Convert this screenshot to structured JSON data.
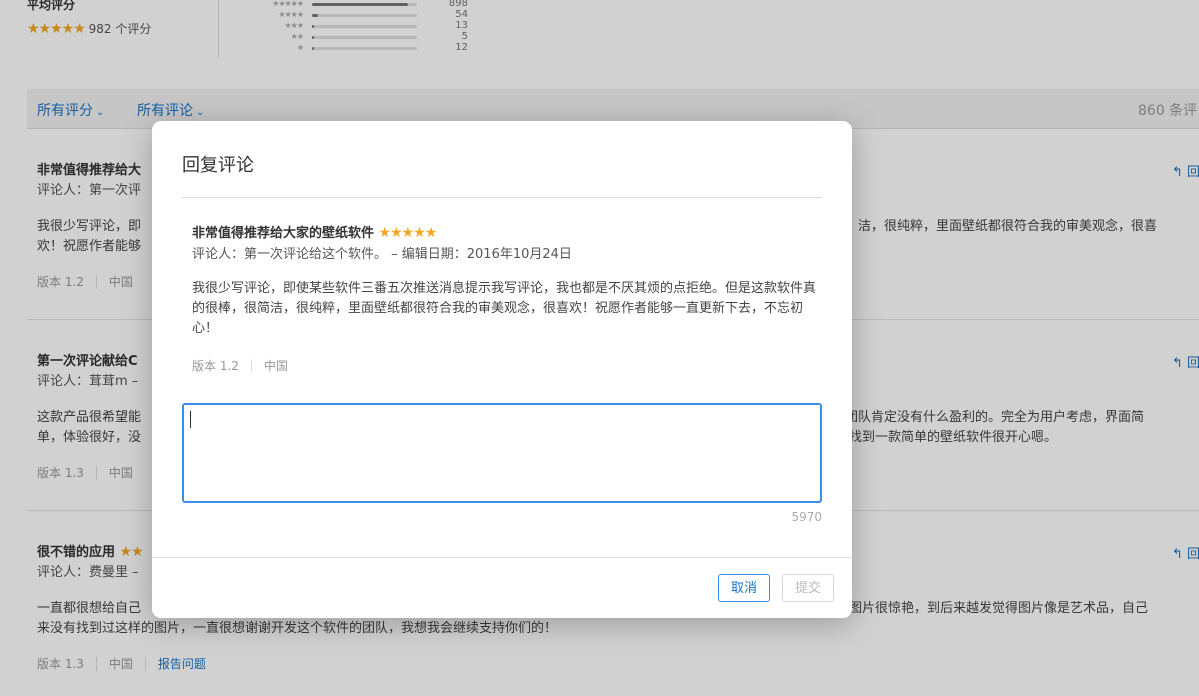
{
  "summary": {
    "avg_label": "平均评分",
    "avg_stars": "★★★★★",
    "rating_count": "982 个评分",
    "histogram": [
      {
        "stars": "★★★★★",
        "count": "898",
        "fraction": 0.915
      },
      {
        "stars": "★★★★",
        "count": "54",
        "fraction": 0.055
      },
      {
        "stars": "★★★",
        "count": "13",
        "fraction": 0.013
      },
      {
        "stars": "★★",
        "count": "5",
        "fraction": 0.005
      },
      {
        "stars": "★",
        "count": "12",
        "fraction": 0.012
      }
    ]
  },
  "filters": {
    "all_ratings": "所有评分",
    "all_reviews": "所有评论",
    "review_count": "860 条评"
  },
  "reviews": [
    {
      "title": "非常值得推荐给大",
      "meta": "评论人：第一次评",
      "body_line1": "我很少写评论，即",
      "body_line1_right": "洁，很纯粹，里面壁纸都很符合我的审美观念，很喜",
      "body_line2": "欢！祝愿作者能够",
      "version": "版本 1.2",
      "country": "中国",
      "reply": "回"
    },
    {
      "title": "第一次评论献给C",
      "meta": "评论人：茸茸m –",
      "body_line1": "这款产品很希望能",
      "body_line1_right": "团队肯定没有什么盈利的。完全为用户考虑，界面简",
      "body_line2": "单，体验很好，没",
      "body_line2_right": "找到一款简单的壁纸软件很开心嗯。",
      "version": "版本 1.3",
      "country": "中国",
      "reply": "回"
    },
    {
      "title": "很不错的应用",
      "title_stars": "★★",
      "meta": "评论人：费曼里 –",
      "body_line1": "一直都很想给自己",
      "body_line1_right": "图片很惊艳，到后来越发觉得图片像是艺术品，自己",
      "body_line2": "来没有找到过这样的图片，一直很想谢谢开发这个软件的团队，我想我会继续支持你们的！",
      "version": "版本 1.3",
      "country": "中国",
      "report": "报告问题",
      "reply": "回"
    }
  ],
  "modal": {
    "title": "回复评论",
    "review_title": "非常值得推荐给大家的壁纸软件",
    "review_stars": "★★★★★",
    "review_meta": "评论人：第一次评论给这个软件。 – 编辑日期：2016年10月24日",
    "review_body": "我很少写评论，即使某些软件三番五次推送消息提示我写评论，我也都是不厌其烦的点拒绝。但是这款软件真的很棒，很简洁，很纯粹，里面壁纸都很符合我的审美观念，很喜欢！祝愿作者能够一直更新下去，不忘初心！",
    "version": "版本 1.2",
    "country": "中国",
    "reply_value": "",
    "char_count": "5970",
    "cancel_label": "取消",
    "submit_label": "提交"
  },
  "colors": {
    "accent": "#1a73c8",
    "star": "#f5a623",
    "focus_border": "#3b8ee6"
  }
}
